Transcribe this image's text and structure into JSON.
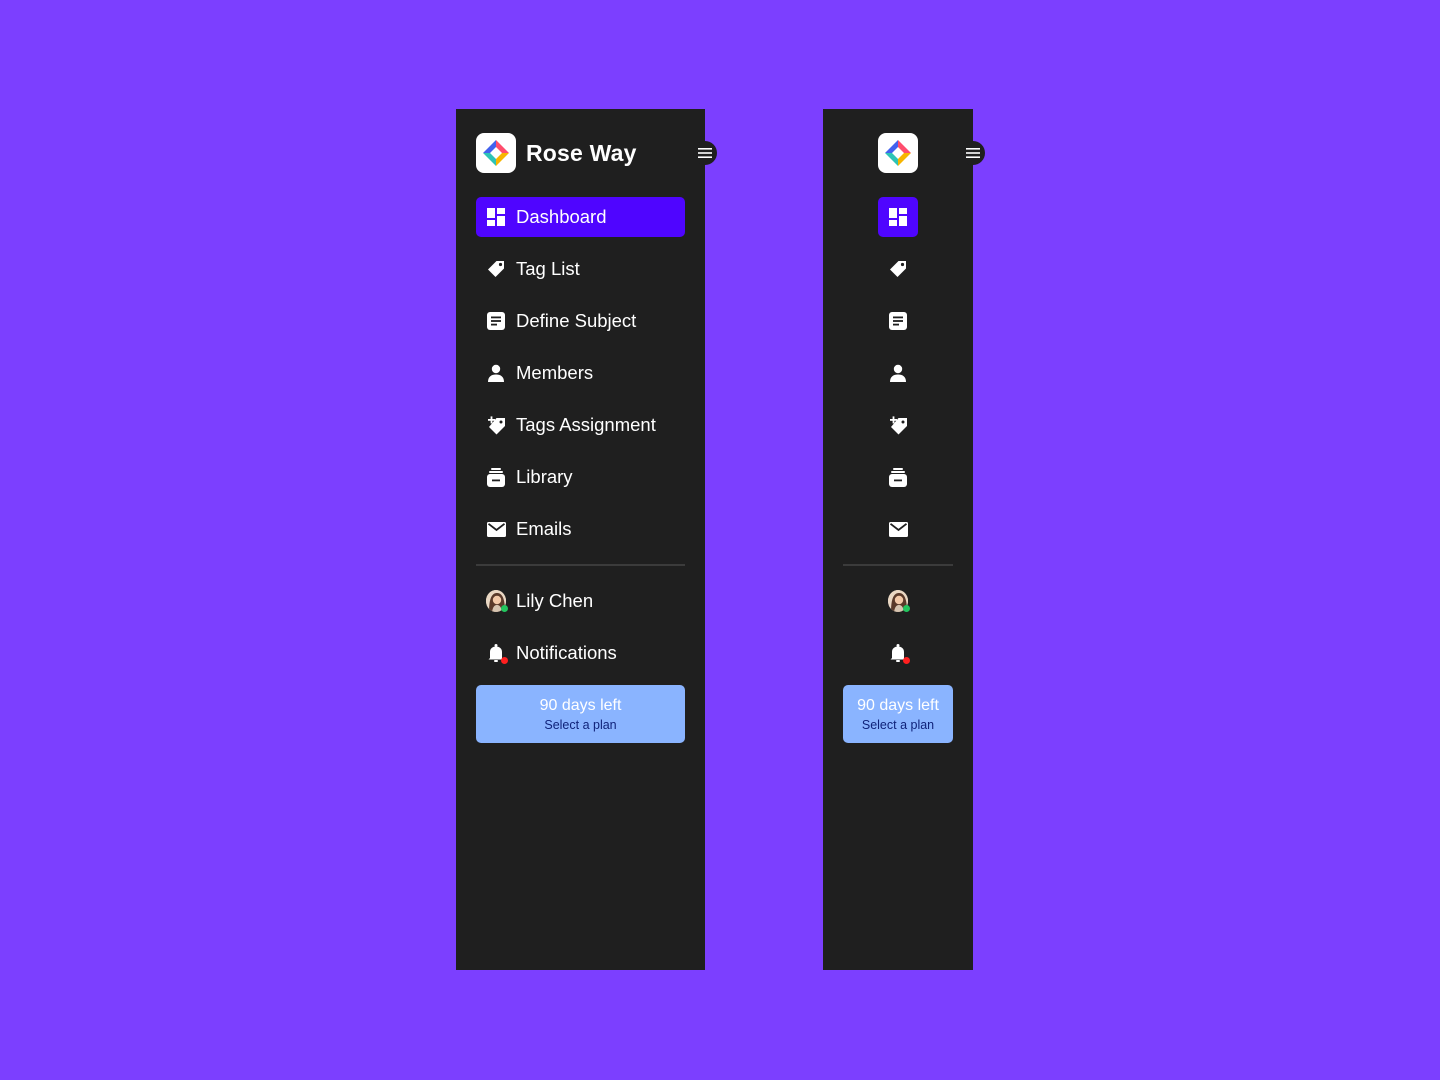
{
  "app": {
    "name": "Rose Way"
  },
  "nav": {
    "items": [
      {
        "label": "Dashboard",
        "icon": "dashboard-icon",
        "active": true
      },
      {
        "label": "Tag List",
        "icon": "tag-icon"
      },
      {
        "label": "Define Subject",
        "icon": "subject-icon"
      },
      {
        "label": "Members",
        "icon": "person-icon"
      },
      {
        "label": "Tags Assignment",
        "icon": "tag-add-icon"
      },
      {
        "label": "Library",
        "icon": "library-icon"
      },
      {
        "label": "Emails",
        "icon": "mail-icon"
      }
    ]
  },
  "user": {
    "name": "Lily Chen",
    "status": "online"
  },
  "notifications": {
    "label": "Notifications",
    "has_unread": true
  },
  "plan": {
    "title": "90 days left",
    "subtitle": "Select a plan"
  },
  "colors": {
    "background": "#7c3fff",
    "sidebar": "#1f1f1f",
    "active": "#4f05ff",
    "plan_card": "#8ab4ff"
  }
}
